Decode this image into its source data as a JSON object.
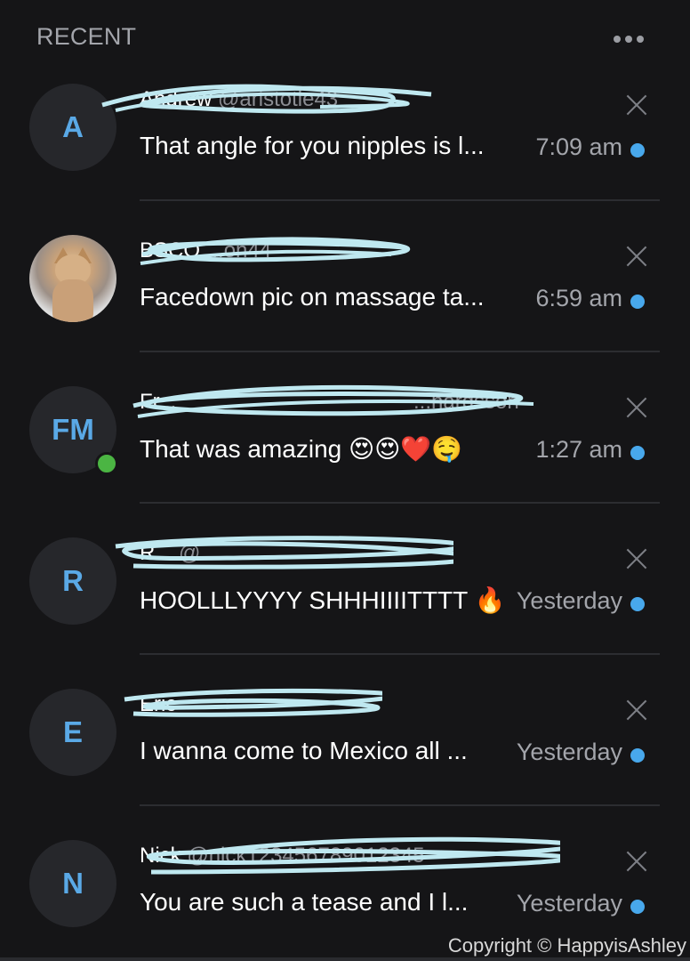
{
  "header": {
    "title": "RECENT",
    "more_icon": "more-horizontal-icon"
  },
  "colors": {
    "accent": "#48a8ec",
    "background": "#151517",
    "online": "#4bb543"
  },
  "conversations": [
    {
      "initials": "A",
      "name": "Andrew",
      "handle": "@aristotle43",
      "message": "That angle for you nipples is l...",
      "time": "7:09 am",
      "avatar_type": "initials"
    },
    {
      "initials": "",
      "name": "BSCO",
      "handle": "...on44",
      "message": "Facedown pic on massage ta...",
      "time": "6:59 am",
      "avatar_type": "photo"
    },
    {
      "initials": "FM",
      "name": "Fr...",
      "handle": "...hardsson",
      "message": "That was amazing 😍😍❤️🤤",
      "time": "1:27 am",
      "avatar_type": "initials",
      "online": true
    },
    {
      "initials": "R",
      "name": "R...",
      "handle": "@...",
      "message": "HOOLLLYYYY SHHHIIIITTTT 🔥",
      "time": "Yesterday",
      "avatar_type": "initials"
    },
    {
      "initials": "E",
      "name": "Eric",
      "handle": "",
      "message": "I wanna come to Mexico all ...",
      "time": "Yesterday",
      "avatar_type": "initials"
    },
    {
      "initials": "N",
      "name": "Nick",
      "handle": "@nick123456789012345",
      "message": "You are such a tease and I l...",
      "time": "Yesterday",
      "avatar_type": "initials"
    }
  ],
  "footer": {
    "copyright": "Copyright © HappyisAshley"
  }
}
